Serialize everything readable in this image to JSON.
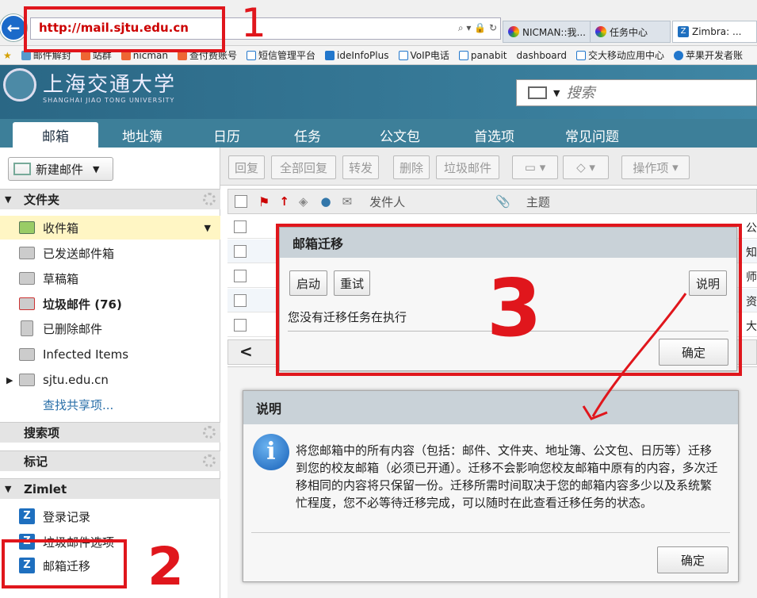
{
  "browser": {
    "url": "http://mail.sjtu.edu.cn",
    "tabs": [
      {
        "label": "NICMAN::我..."
      },
      {
        "label": "任务中心"
      },
      {
        "label": "Zimbra: ..."
      }
    ],
    "bookmarks": [
      "邮件解封",
      "站群",
      "nicman",
      "查付费账号",
      "短信管理平台",
      "ideInfoPlus",
      "VoIP电话",
      "panabit",
      "dashboard",
      "交大移动应用中心",
      "苹果开发者账"
    ]
  },
  "header": {
    "logo_cn": "上海交通大学",
    "logo_en": "SHANGHAI JIAO TONG UNIVERSITY",
    "search_placeholder": "搜索"
  },
  "app_tabs": [
    "邮箱",
    "地址簿",
    "日历",
    "任务",
    "公文包",
    "首选项",
    "常见问题"
  ],
  "left_panel": {
    "new_mail": "新建邮件",
    "folders_heading": "文件夹",
    "folders": [
      {
        "label": "收件箱"
      },
      {
        "label": "已发送邮件箱"
      },
      {
        "label": "草稿箱"
      },
      {
        "label": "垃圾邮件 (76)"
      },
      {
        "label": "已删除邮件"
      },
      {
        "label": "Infected Items"
      },
      {
        "label": "sjtu.edu.cn"
      }
    ],
    "find_shares": "查找共享项...",
    "searches_heading": "搜索项",
    "tags_heading": "标记",
    "zimlet_heading": "Zimlet",
    "zimlets": [
      {
        "label": "登录记录"
      },
      {
        "label": "垃圾邮件选项"
      },
      {
        "label": "邮箱迁移"
      }
    ]
  },
  "toolbar": {
    "reply": "回复",
    "reply_all": "全部回复",
    "forward": "转发",
    "delete": "删除",
    "spam": "垃圾邮件",
    "actions": "操作项"
  },
  "message_list": {
    "from_header": "发件人",
    "subject_header": "主题",
    "row_tails": [
      "公",
      "知",
      "师",
      "资",
      "大"
    ]
  },
  "migration_dialog": {
    "title": "邮箱迁移",
    "start": "启动",
    "retry": "重试",
    "help": "说明",
    "status": "您没有迁移任务在执行",
    "ok": "确定"
  },
  "help_dialog": {
    "title": "说明",
    "text": "将您邮箱中的所有内容（包括：邮件、文件夹、地址簿、公文包、日历等）迁移到您的校友邮箱（必须已开通）。迁移不会影响您校友邮箱中原有的内容，多次迁移相同的内容将只保留一份。迁移所需时间取决于您的邮箱内容多少以及系统繁忙程度，您不必等待迁移完成，可以随时在此查看迁移任务的状态。",
    "ok": "确定"
  },
  "annotations": [
    "1",
    "2",
    "3"
  ],
  "colors": {
    "annotation_red": "#e0161c",
    "header_blue": "#3d7f99"
  }
}
